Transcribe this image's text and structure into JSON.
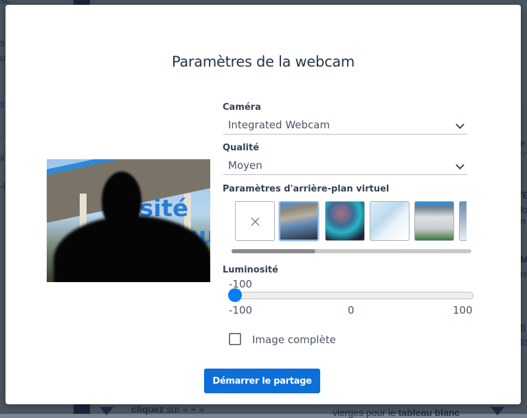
{
  "background": {
    "left_fragments": [
      "ssc",
      "s",
      "u",
      "tt",
      "oi",
      "-l"
    ],
    "right_fragments": [
      "e",
      "ua",
      "'E",
      "lo",
      "n a",
      "M",
      "re",
      "ti",
      "ec"
    ],
    "bottom_left": {
      "bold": "cliquez",
      "text": " sur « + »"
    },
    "bottom_right": {
      "text": "vierges pour le ",
      "bold": "tableau blanc"
    }
  },
  "modal": {
    "title": "Paramètres de la webcam",
    "camera": {
      "label": "Caméra",
      "value": "Integrated Webcam"
    },
    "quality": {
      "label": "Qualité",
      "value": "Moyen"
    },
    "virtual_background": {
      "label": "Paramètres d'arrière-plan virtuel",
      "options": [
        {
          "name": "none",
          "selected": false
        },
        {
          "name": "campus-entrance",
          "selected": true
        },
        {
          "name": "blurred-lights",
          "selected": false
        },
        {
          "name": "blue-pattern",
          "selected": false
        },
        {
          "name": "campus-building",
          "selected": false
        },
        {
          "name": "campus-sign",
          "selected": false
        }
      ],
      "scroll_fraction": 0.35
    },
    "brightness": {
      "label": "Luminosité",
      "current": "-100",
      "value": -100,
      "min": -100,
      "max": 100,
      "ticks": [
        "-100",
        "0",
        "100"
      ]
    },
    "full_image": {
      "label": "Image complète",
      "checked": false
    },
    "start_button": "Démarrer le partage",
    "colors": {
      "accent": "#0f6fd9",
      "slider_knob": "#0a7cf4",
      "title": "#253445"
    }
  }
}
